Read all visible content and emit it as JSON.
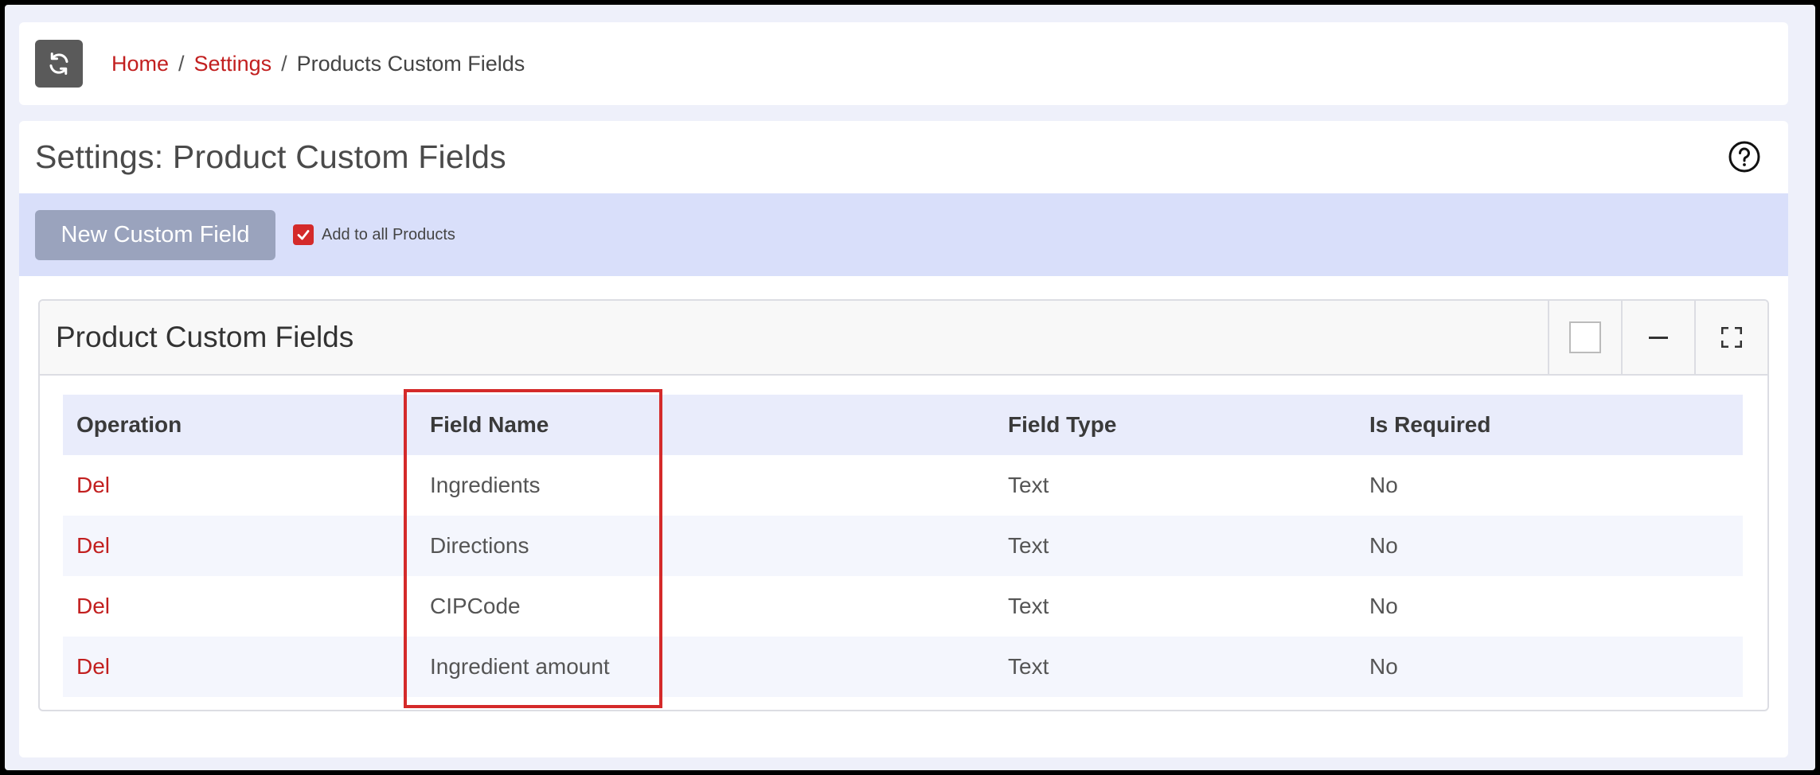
{
  "breadcrumb": {
    "home": "Home",
    "settings": "Settings",
    "current": "Products Custom Fields",
    "separator": "/"
  },
  "page": {
    "title": "Settings: Product Custom Fields"
  },
  "toolbar": {
    "new_button_label": "New Custom Field",
    "add_all_label": "Add to all Products",
    "add_all_checked": true
  },
  "card": {
    "title": "Product Custom Fields"
  },
  "table": {
    "columns": [
      "Operation",
      "Field Name",
      "Field Type",
      "Is Required"
    ],
    "rows": [
      {
        "operation": "Del",
        "field_name": "Ingredients",
        "field_type": "Text",
        "is_required": "No"
      },
      {
        "operation": "Del",
        "field_name": "Directions",
        "field_type": "Text",
        "is_required": "No"
      },
      {
        "operation": "Del",
        "field_name": "CIPCode",
        "field_type": "Text",
        "is_required": "No"
      },
      {
        "operation": "Del",
        "field_name": "Ingredient amount",
        "field_type": "Text",
        "is_required": "No"
      }
    ]
  },
  "icons": {
    "refresh": "refresh-icon",
    "help": "help-circle-icon",
    "checkbox": "checkmark-icon",
    "select_all": "square-icon",
    "collapse": "minus-icon",
    "fullscreen": "expand-icon"
  },
  "colors": {
    "accent_red": "#c21f1f",
    "toolbar_bg": "#d9dffa",
    "button_bg": "#9aa3bd",
    "highlight": "#d42a2a"
  }
}
